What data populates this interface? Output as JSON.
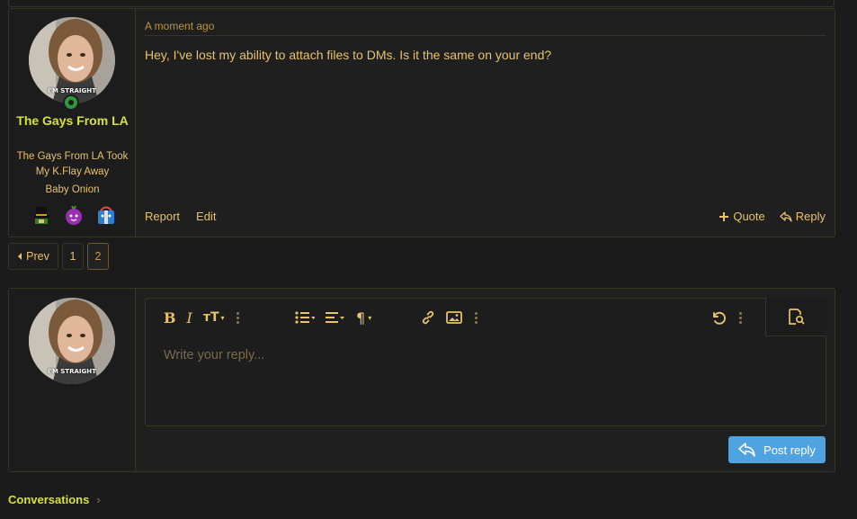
{
  "message": {
    "user": {
      "name": "The Gays From LA",
      "title": "The Gays From LA Took My K.Flay Away",
      "banner": "Baby Onion",
      "avatar_caption": "I'M STRAIGHT",
      "trophies": [
        "top-hat-trophy-icon",
        "onion-trophy-icon",
        "gift-trophy-icon"
      ]
    },
    "timestamp": "A moment ago",
    "body": "Hey, I've lost my ability to attach files to DMs. Is it the same on your end?",
    "actions_left": {
      "report": "Report",
      "edit": "Edit"
    },
    "actions_right": {
      "quote": "Quote",
      "reply": "Reply"
    }
  },
  "pagination": {
    "prev": "Prev",
    "pages": [
      "1",
      "2"
    ],
    "current": "2"
  },
  "reply": {
    "avatar_caption": "I'M STRAIGHT",
    "placeholder": "Write your reply...",
    "post_button": "Post reply",
    "toolbar": [
      "bold-icon",
      "italic-icon",
      "text-size-icon",
      "more-icon",
      "list-icon",
      "align-icon",
      "paragraph-icon",
      "more-icon",
      "link-icon",
      "image-icon",
      "more-icon",
      "undo-icon",
      "more-icon",
      "preview-icon"
    ]
  },
  "breadcrumb": {
    "label": "Conversations"
  },
  "colors": {
    "accent": "#e8c16a",
    "username": "#d6e23a",
    "button": "#4fa3e0",
    "background": "#1b1b1b"
  }
}
